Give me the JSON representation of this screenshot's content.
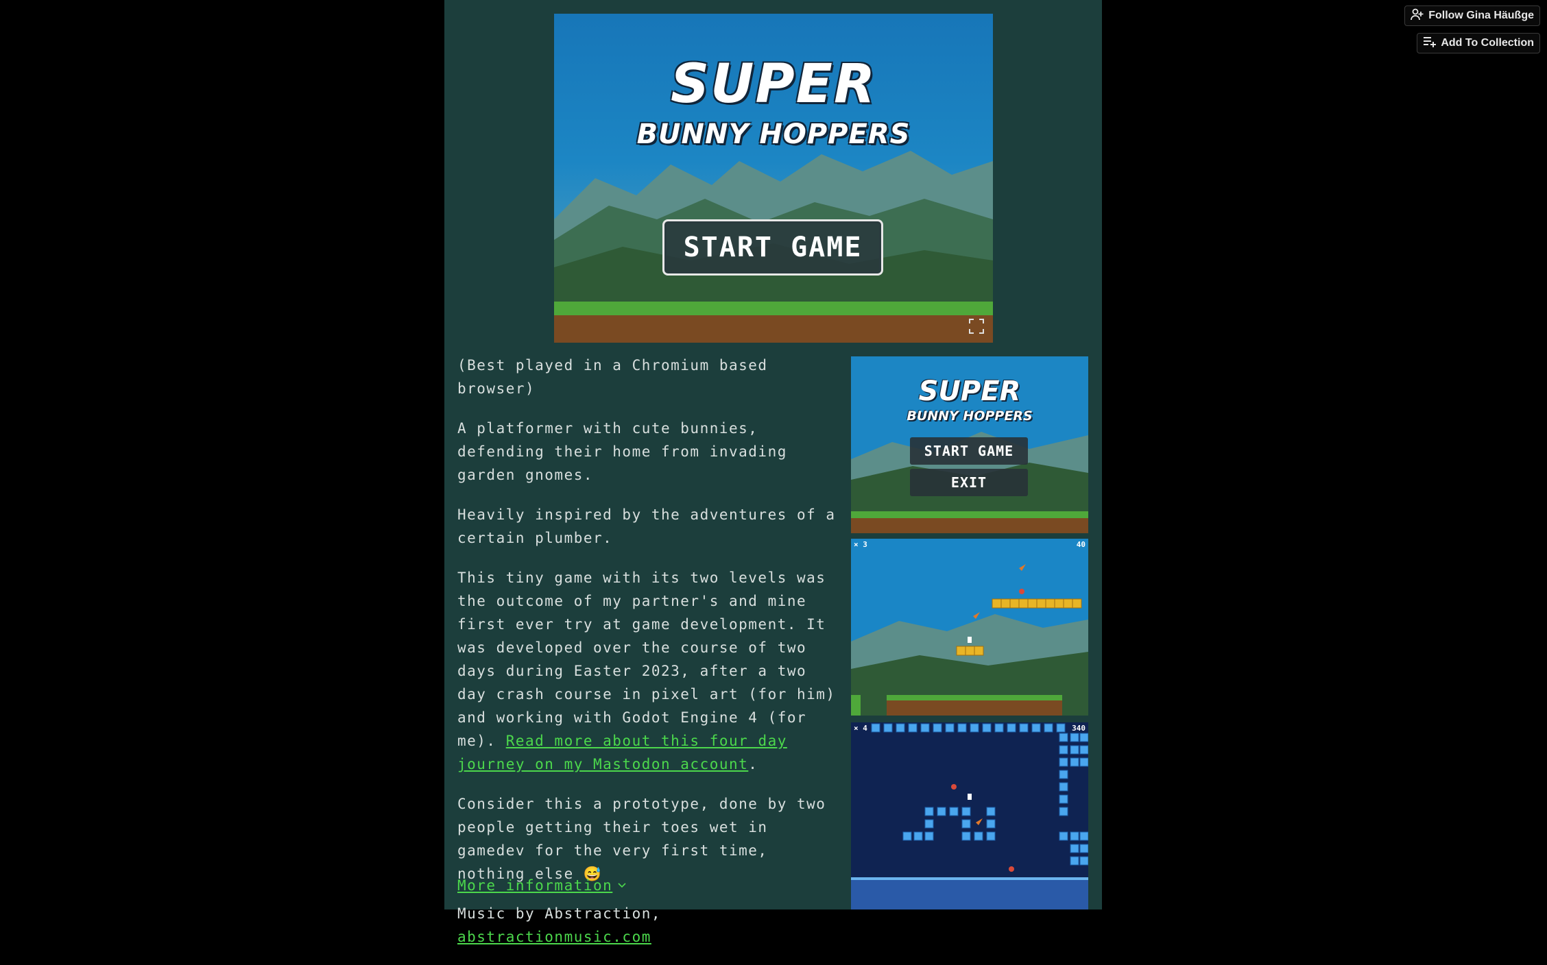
{
  "header": {
    "follow_label": "Follow Gina Häußge",
    "collection_label": "Add To Collection"
  },
  "game": {
    "title_line1": "SUPER",
    "title_line2": "BUNNY HOPPERS",
    "start_label": "START GAME",
    "fullscreen_icon": "fullscreen-icon"
  },
  "description": {
    "p1": "(Best played in a Chromium based browser)",
    "p2": "A platformer with cute bunnies, defending their home from invading garden gnomes.",
    "p3": "Heavily inspired by the adventures of a certain plumber.",
    "p4_text": "This tiny game with its two levels was the outcome of my partner's and mine first ever try at game development. It was developed over the course of two days during Easter 2023, after a two day crash course in pixel art (for him) and working with Godot Engine 4 (for me). ",
    "p4_link": "Read more about this four day journey on my Mastodon account",
    "p4_end": ".",
    "p5": "Consider this a prototype, done by two people getting their toes wet in gamedev for the very first time, nothing else 😅",
    "p6_text": "Music by Abstraction, ",
    "p6_link": "abstractionmusic.com"
  },
  "more_info": "More information",
  "screenshots": {
    "shot1": {
      "title_line1": "SUPER",
      "title_line2": "BUNNY HOPPERS",
      "start_label": "START GAME",
      "exit_label": "EXIT"
    },
    "shot2": {
      "lives": "× 3",
      "score": "40"
    },
    "shot3": {
      "lives": "× 4",
      "score": "340"
    }
  },
  "colors": {
    "page_bg": "#000000",
    "column_bg": "#1c3e3c",
    "text": "#d8dfde",
    "link": "#4cd84c"
  }
}
